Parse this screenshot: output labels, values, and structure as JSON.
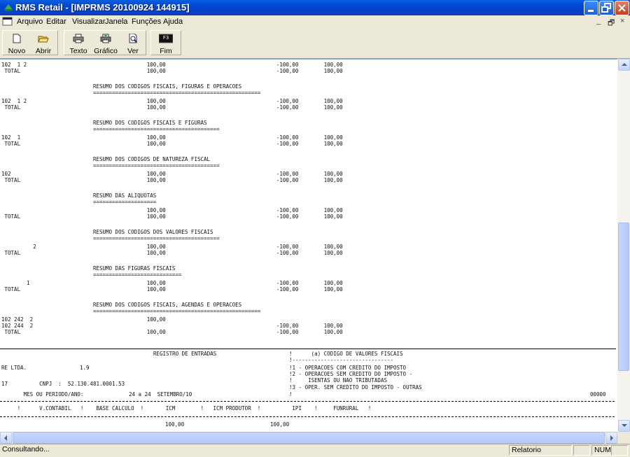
{
  "window": {
    "title": "RMS Retail - [IMPRMS 20100924 144915]"
  },
  "menu": {
    "items": [
      "Arquivo",
      "Editar",
      "Visualizar",
      "Janela",
      "Funções",
      "Ajuda"
    ],
    "mdi_controls": [
      "_",
      "🗗",
      "×"
    ]
  },
  "toolbar": {
    "buttons": [
      {
        "label": "Novo",
        "icon": "new-document-icon"
      },
      {
        "label": "Abrir",
        "icon": "open-folder-icon"
      },
      {
        "label": "Texto",
        "icon": "printer-icon"
      },
      {
        "label": "Gráfico",
        "icon": "printer-graphic-icon"
      },
      {
        "label": "Ver",
        "icon": "print-preview-icon"
      },
      {
        "label": "Fim",
        "icon": "f3-key-icon",
        "key": "F3"
      }
    ]
  },
  "report": {
    "lines": [
      "102  1 2                                      100,00                                   -100,00        100,00",
      " TOTAL                                        100,00                                   -100,00        100,00",
      "",
      "                             RESUMO DOS CODIGOS FISCAIS, FIGURAS E OPERACOES",
      "                             =====================================================",
      "102  1 2                                      100,00                                   -100,00        100,00",
      " TOTAL                                        100,00                                   -100,00        100,00",
      "",
      "                             RESUMO DOS CODIGOS FISCAIS E FIGURAS",
      "                             ========================================",
      "102  1                                        100,00                                   -100,00        100,00",
      " TOTAL                                        100,00                                   -100,00        100,00",
      "",
      "                             RESUMO DOS CODIGOS DE NATUREZA FISCAL",
      "                             ========================================",
      "102                                           100,00                                   -100,00        100,00",
      " TOTAL                                        100,00                                   -100,00        100,00",
      "",
      "                             RESUMO DAS ALIQUOTAS",
      "                             ====================",
      "                                              100,00                                   -100,00        100,00",
      " TOTAL                                        100,00                                   -100,00        100,00",
      "",
      "                             RESUMO DOS CODIGOS DOS VALORES FISCAIS",
      "                             ========================================",
      "          2                                   100,00                                   -100,00        100,00",
      " TOTAL                                        100,00                                   -100,00        100,00",
      "",
      "                             RESUMO DAS FIGURAS FISCAIS",
      "                             ============================",
      "        1                                     100,00                                   -100,00        100,00",
      " TOTAL                                        100,00                                   -100,00        100,00",
      "",
      "                             RESUMO DOS CODIGOS FISCAIS, AGENDAS E OPERACOES",
      "                             =====================================================",
      "102 242  2                                    100,00",
      "102 244  2                                                                             -100,00        100,00",
      " TOTAL                                        100,00                                   -100,00        100,00"
    ],
    "register_title": "REGISTRO DE ENTRADAS",
    "legend_title": "!      (a) CODIGO DE VALORES FISCAIS",
    "legend_sep": "!--------------------------------",
    "company_left": "RE LTDA.",
    "company_code": "1.9",
    "legend_1": "!1 - OPERACOES COM CREDITO DO IMPOSTO",
    "legend_2": "!2 - OPERACOES SEM CREDITO DO IMPOSTO -",
    "legend_2b": "!     ISENTAS OU NAO TRIBUTADAS",
    "legend_3": "!3 - OPER. SEM CREDITO DO IMPOSTO - OUTRAS",
    "cnpj_line": "17          CNPJ  :  52.130.481.0001.53",
    "period_label": "       MES OU PERIODO/ANO:",
    "period_value": "24 a 24  SETEMBRO/10",
    "legend_end": "!",
    "page_no": "00000",
    "col_header": "     !      V.CONTABIL   !    BASE CALCULO  !       ICM        !   ICM PRODUTOR  !          IPI    !     FUNRURAL   !",
    "bottom_values_1": "100,00",
    "bottom_values_2": "100,00"
  },
  "status": {
    "left": "Consultando...",
    "mode": "Relatorio",
    "num": "NUM"
  },
  "colors": {
    "title_blue": "#0a47d6",
    "face": "#ece9d8"
  }
}
